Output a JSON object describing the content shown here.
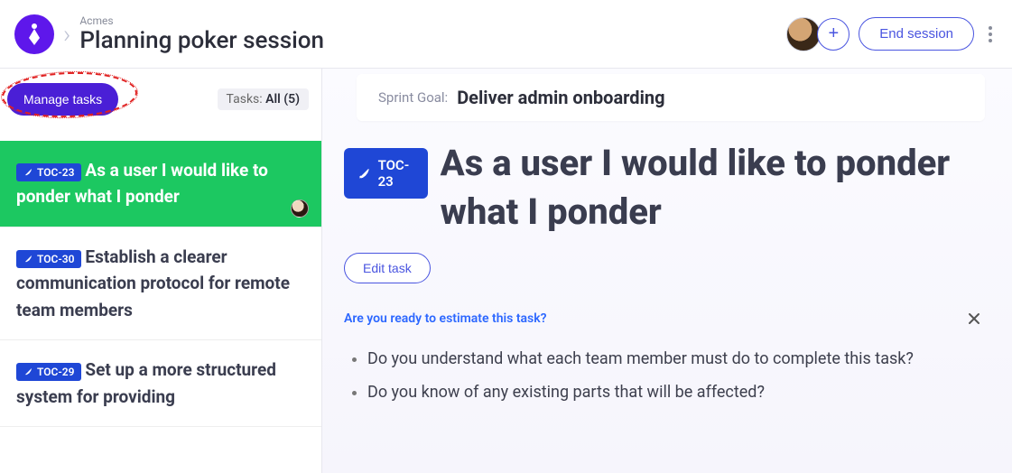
{
  "header": {
    "org": "Acmes",
    "title": "Planning poker session",
    "end_label": "End session"
  },
  "sidebar": {
    "manage_label": "Manage tasks",
    "filter_prefix": "Tasks: ",
    "filter_value": "All (5)"
  },
  "tasks": [
    {
      "key": "TOC-23",
      "title": "As a user I would like to ponder what I ponder",
      "active": true
    },
    {
      "key": "TOC-30",
      "title": "Establish a clearer communication protocol for remote team members",
      "active": false
    },
    {
      "key": "TOC-29",
      "title": "Set up a more structured system for providing",
      "active": false
    }
  ],
  "sprint": {
    "label": "Sprint Goal:",
    "value": "Deliver admin onboarding"
  },
  "detail": {
    "key": "TOC-23",
    "title": "As a user I would like to ponder what I ponder",
    "edit_label": "Edit task",
    "prompt": "Are you ready to estimate this task?",
    "questions": [
      "Do you understand what each team member must do to complete this task?",
      "Do you know of any existing parts that will be affected?"
    ]
  }
}
